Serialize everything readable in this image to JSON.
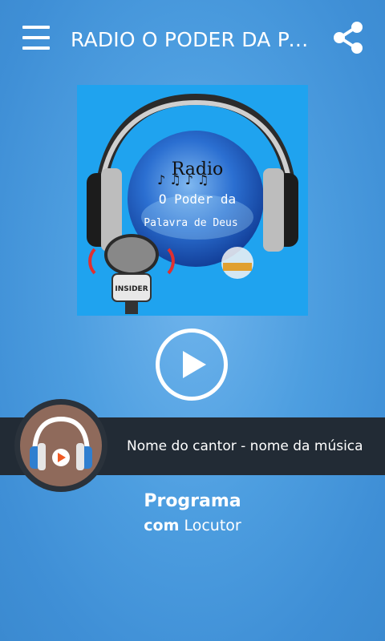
{
  "header": {
    "title": "RADIO O PODER DA PALAVRA DE DEUS",
    "menu_icon": "hamburger-menu-icon",
    "share_icon": "share-icon"
  },
  "cover": {
    "line1": "Radio",
    "line2": "O Poder da",
    "line3": "Palavra de Deus",
    "mic_label": "INSIDER",
    "colors": {
      "background": "#1fa3ef"
    }
  },
  "player": {
    "play_icon": "play-icon",
    "now_playing": "Nome do cantor - nome da música",
    "art_icon": "headphones-icon"
  },
  "program": {
    "title": "Programa",
    "host_prefix": "com",
    "host_name": "Locutor"
  },
  "colors": {
    "bar": "#222b35",
    "art_bg": "#8f6a5b",
    "accent_orange": "#f05a24",
    "headphone_blue": "#2f7fd0"
  }
}
